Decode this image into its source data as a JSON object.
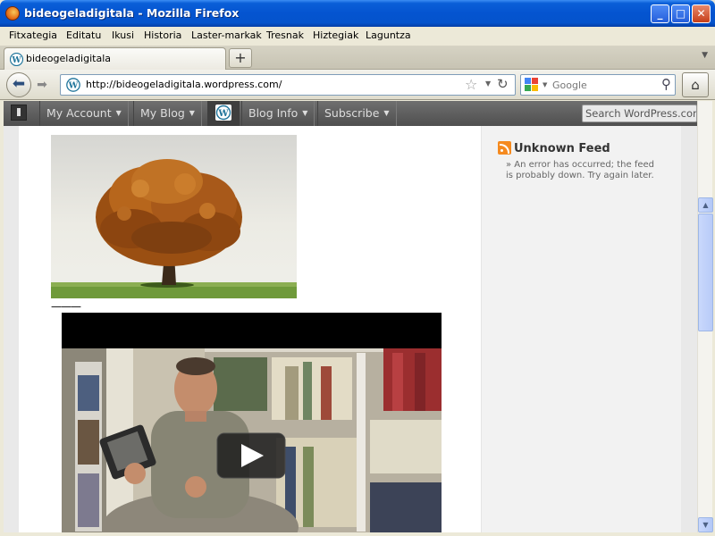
{
  "window": {
    "title": "bideogeladigitala - Mozilla Firefox",
    "controls": {
      "minimize": "_",
      "maximize": "□",
      "close": "✕"
    }
  },
  "menubar": {
    "items": [
      "Fitxategia",
      "Editatu",
      "Ikusi",
      "Historia",
      "Laster-markak",
      "Tresnak",
      "Hiztegiak",
      "Laguntza"
    ]
  },
  "tabs": {
    "active_label": "bideogeladigitala",
    "new_tab_symbol": "+"
  },
  "navbar": {
    "url": "http://bideogeladigitala.wordpress.com/",
    "search_placeholder": "Google"
  },
  "adminbar": {
    "items": [
      "My Account",
      "My Blog",
      "Blog Info",
      "Subscribe"
    ],
    "search_placeholder": "Search WordPress.com"
  },
  "content": {
    "separator": "———"
  },
  "sidebar": {
    "widget_title": "Unknown Feed",
    "widget_text": "» An error has occurred; the feed is probably down. Try again later."
  },
  "colors": {
    "titlebar": "#0454d0",
    "adminbar": "#5f5f5f",
    "rss": "#f58a1f"
  }
}
